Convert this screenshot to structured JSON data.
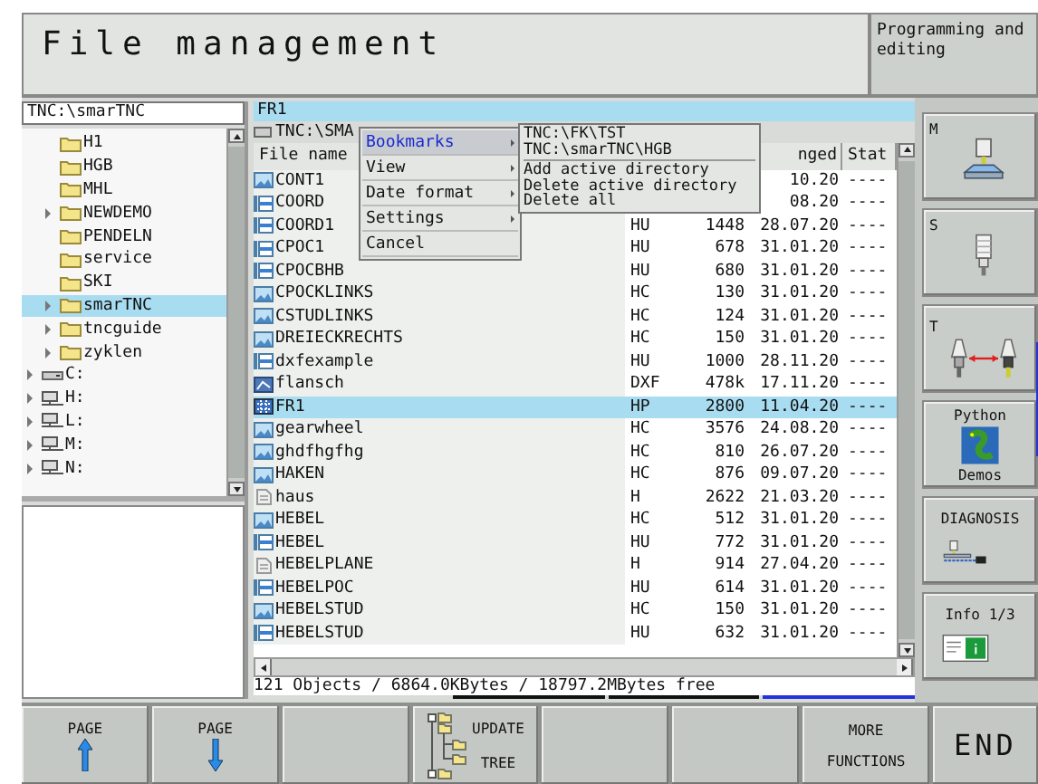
{
  "title": "File management",
  "mode": "Programming and editing",
  "tree_path": "TNC:\\smarTNC",
  "tree": [
    {
      "label": "H1",
      "kind": "folder",
      "expandable": false,
      "selected": false
    },
    {
      "label": "HGB",
      "kind": "folder",
      "expandable": false,
      "selected": false
    },
    {
      "label": "MHL",
      "kind": "folder",
      "expandable": false,
      "selected": false
    },
    {
      "label": "NEWDEMO",
      "kind": "folder",
      "expandable": true,
      "selected": false
    },
    {
      "label": "PENDELN",
      "kind": "folder",
      "expandable": false,
      "selected": false
    },
    {
      "label": "service",
      "kind": "folder",
      "expandable": false,
      "selected": false
    },
    {
      "label": "SKI",
      "kind": "folder",
      "expandable": false,
      "selected": false
    },
    {
      "label": "smarTNC",
      "kind": "folder",
      "expandable": true,
      "selected": true
    },
    {
      "label": "tncguide",
      "kind": "folder",
      "expandable": true,
      "selected": false
    },
    {
      "label": "zyklen",
      "kind": "folder",
      "expandable": true,
      "selected": false
    },
    {
      "label": "C:",
      "kind": "drive",
      "expandable": true,
      "selected": false
    },
    {
      "label": "H:",
      "kind": "network-drive",
      "expandable": true,
      "selected": false
    },
    {
      "label": "L:",
      "kind": "network-drive",
      "expandable": true,
      "selected": false
    },
    {
      "label": "M:",
      "kind": "network-drive",
      "expandable": true,
      "selected": false
    },
    {
      "label": "N:",
      "kind": "network-drive",
      "expandable": true,
      "selected": false
    }
  ],
  "filter": "FR1",
  "path": "TNC:\\SMA",
  "columns": {
    "name": "File name",
    "changed": "nged",
    "status": "Stat"
  },
  "files": [
    {
      "name": "CONT1",
      "kind": "hc",
      "changed": "10.20",
      "status": "----",
      "selected": false
    },
    {
      "name": "COORD",
      "kind": "hu",
      "changed": "08.20",
      "status": "----",
      "selected": false
    },
    {
      "name": "COORD1",
      "kind": "hu",
      "type": "HU",
      "size": "1448",
      "changed": "28.07.20",
      "status": "----",
      "selected": false
    },
    {
      "name": "CPOC1",
      "kind": "hu",
      "type": "HU",
      "size": "678",
      "changed": "31.01.20",
      "status": "----",
      "selected": false
    },
    {
      "name": "CPOCBHB",
      "kind": "hu",
      "type": "HU",
      "size": "680",
      "changed": "31.01.20",
      "status": "----",
      "selected": false
    },
    {
      "name": "CPOCKLINKS",
      "kind": "hc",
      "type": "HC",
      "size": "130",
      "changed": "31.01.20",
      "status": "----",
      "selected": false
    },
    {
      "name": "CSTUDLINKS",
      "kind": "hc",
      "type": "HC",
      "size": "124",
      "changed": "31.01.20",
      "status": "----",
      "selected": false
    },
    {
      "name": "DREIECKRECHTS",
      "kind": "hc",
      "type": "HC",
      "size": "150",
      "changed": "31.01.20",
      "status": "----",
      "selected": false
    },
    {
      "name": "dxfexample",
      "kind": "hu",
      "type": "HU",
      "size": "1000",
      "changed": "28.11.20",
      "status": "----",
      "selected": false
    },
    {
      "name": "flansch",
      "kind": "dxf",
      "type": "DXF",
      "size": "478k",
      "changed": "17.11.20",
      "status": "----",
      "selected": false
    },
    {
      "name": "FR1",
      "kind": "hp",
      "type": "HP",
      "size": "2800",
      "changed": "11.04.20",
      "status": "----",
      "selected": true
    },
    {
      "name": "gearwheel",
      "kind": "hc",
      "type": "HC",
      "size": "3576",
      "changed": "24.08.20",
      "status": "----",
      "selected": false
    },
    {
      "name": "ghdfhgfhg",
      "kind": "hc",
      "type": "HC",
      "size": "810",
      "changed": "26.07.20",
      "status": "----",
      "selected": false
    },
    {
      "name": "HAKEN",
      "kind": "hc",
      "type": "HC",
      "size": "876",
      "changed": "09.07.20",
      "status": "----",
      "selected": false
    },
    {
      "name": "haus",
      "kind": "h",
      "type": "H",
      "size": "2622",
      "changed": "21.03.20",
      "status": "----",
      "selected": false
    },
    {
      "name": "HEBEL",
      "kind": "hc",
      "type": "HC",
      "size": "512",
      "changed": "31.01.20",
      "status": "----",
      "selected": false
    },
    {
      "name": "HEBEL",
      "kind": "hu",
      "type": "HU",
      "size": "772",
      "changed": "31.01.20",
      "status": "----",
      "selected": false
    },
    {
      "name": "HEBELPLANE",
      "kind": "h",
      "type": "H",
      "size": "914",
      "changed": "27.04.20",
      "status": "----",
      "selected": false
    },
    {
      "name": "HEBELPOC",
      "kind": "hu",
      "type": "HU",
      "size": "614",
      "changed": "31.01.20",
      "status": "----",
      "selected": false
    },
    {
      "name": "HEBELSTUD",
      "kind": "hc",
      "type": "HC",
      "size": "150",
      "changed": "31.01.20",
      "status": "----",
      "selected": false
    },
    {
      "name": "HEBELSTUD",
      "kind": "hu",
      "type": "HU",
      "size": "632",
      "changed": "31.01.20",
      "status": "----",
      "selected": false
    }
  ],
  "status_bar": "121 Objects / 6864.0KBytes / 18797.2MBytes free",
  "menu": [
    {
      "label": "Bookmarks",
      "submenu": true,
      "selected": true
    },
    {
      "label": "View",
      "submenu": true,
      "selected": false
    },
    {
      "label": "Date format",
      "submenu": true,
      "selected": false
    },
    {
      "label": "Settings",
      "submenu": true,
      "selected": false
    },
    {
      "label": "Cancel",
      "submenu": false,
      "selected": false
    }
  ],
  "bookmarks": {
    "entries": [
      "TNC:\\FK\\TST",
      "TNC:\\smarTNC\\HGB"
    ],
    "actions": [
      "Add active directory",
      "Delete active directory",
      "Delete all"
    ]
  },
  "side_keys": [
    {
      "kind": "machine",
      "label": "M"
    },
    {
      "kind": "spindle",
      "label": "S"
    },
    {
      "kind": "tool-change",
      "label": "T"
    },
    {
      "kind": "python",
      "label": "Python",
      "sublabel": "Demos"
    },
    {
      "kind": "diagnosis",
      "label": "DIAGNOSIS"
    },
    {
      "kind": "info",
      "label": "Info 1/3"
    }
  ],
  "softkeys": [
    {
      "kind": "page-up",
      "label": "PAGE"
    },
    {
      "kind": "page-down",
      "label": "PAGE"
    },
    {
      "kind": "blank"
    },
    {
      "kind": "tree",
      "label": "UPDATE",
      "sublabel": "TREE"
    },
    {
      "kind": "blank"
    },
    {
      "kind": "blank"
    },
    {
      "kind": "text",
      "label": "MORE",
      "sublabel": "FUNCTIONS"
    },
    {
      "kind": "end",
      "label": "END"
    }
  ]
}
